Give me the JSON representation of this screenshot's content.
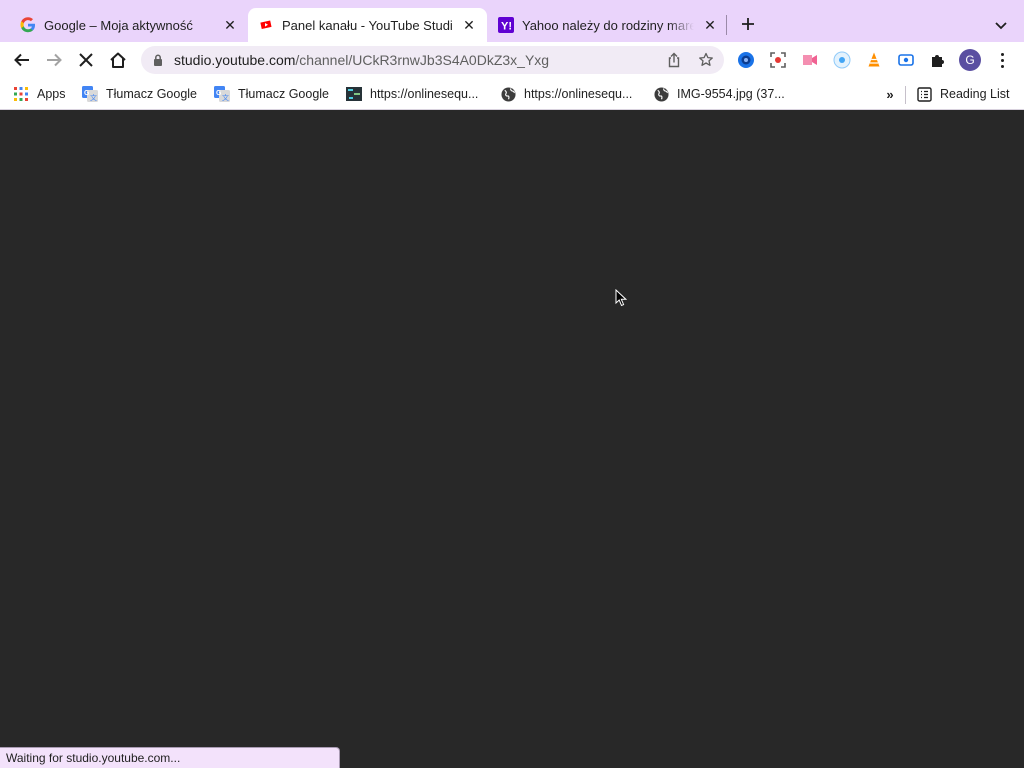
{
  "tabs": [
    {
      "title": "Google – Moja aktywność",
      "favicon": "google-g-icon",
      "active": false
    },
    {
      "title": "Panel kanału - YouTube Studio",
      "favicon": "youtube-studio-icon",
      "active": true
    },
    {
      "title": "Yahoo należy do rodziny marek",
      "favicon": "yahoo-icon",
      "active": false
    }
  ],
  "toolbar": {
    "url_host": "studio.youtube.com",
    "url_path": "/channel/UCkR3rnwJb3S4A0DkZ3x_Yxg",
    "profile_initial": "G"
  },
  "bookmarks": [
    {
      "label": "Apps",
      "icon": "apps-grid-icon"
    },
    {
      "label": "Tłumacz Google",
      "icon": "google-translate-icon"
    },
    {
      "label": "Tłumacz Google",
      "icon": "google-translate-icon"
    },
    {
      "label": "https://onlinesequ...",
      "icon": "sequencer-icon"
    },
    {
      "label": "https://onlinesequ...",
      "icon": "globe-icon"
    },
    {
      "label": "IMG-9554.jpg (37...",
      "icon": "globe-icon"
    }
  ],
  "reading_list": {
    "label": "Reading List",
    "icon": "reading-list-icon"
  },
  "status": {
    "text": "Waiting for studio.youtube.com..."
  },
  "colors": {
    "tabstrip_bg": "#ead4fb",
    "page_bg": "#282828",
    "omnibox_bg": "#f1ebf5",
    "youtube_red": "#ff0000",
    "yahoo_purple": "#6001d2"
  }
}
